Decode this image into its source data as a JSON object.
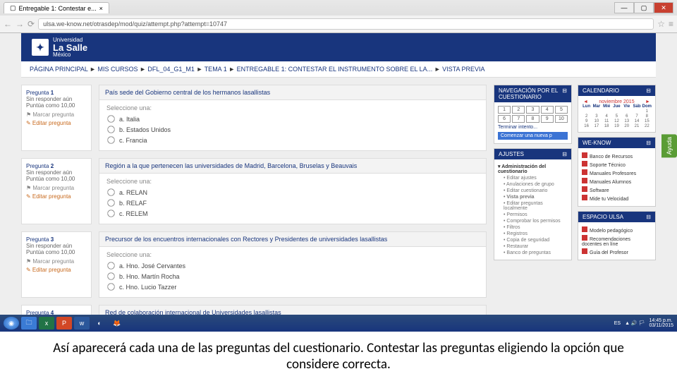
{
  "browser": {
    "tab_title": "Entregable 1: Contestar e...",
    "url": "ulsa.we-know.net/otrasdep/mod/quiz/attempt.php?attempt=10747"
  },
  "logo": {
    "top": "Universidad",
    "name": "La Salle",
    "sub": "México"
  },
  "breadcrumb": {
    "items": [
      "PÁGINA PRINCIPAL",
      "MIS CURSOS",
      "DFL_04_G1_M1",
      "TEMA 1",
      "ENTREGABLE 1: CONTESTAR EL INSTRUMENTO SOBRE EL LA...",
      "VISTA PREVIA"
    ]
  },
  "labels": {
    "question_prefix": "Pregunta",
    "select_one": "Seleccione una:",
    "not_answered": "Sin responder aún",
    "points": "Puntúa como 10,00",
    "flag": "Marcar pregunta",
    "edit": "Editar pregunta"
  },
  "questions": [
    {
      "num": "1",
      "title": "País sede del Gobierno central de los hermanos lasallistas",
      "options": [
        "a. Italia",
        "b. Estados Unidos",
        "c. Francia"
      ]
    },
    {
      "num": "2",
      "title": "Región a la que pertenecen las universidades de Madrid, Barcelona, Bruselas y Beauvais",
      "options": [
        "a. RELAN",
        "b. RELAF",
        "c. RELEM"
      ]
    },
    {
      "num": "3",
      "title": "Precursor de los encuentros internacionales con Rectores y Presidentes de universidades lasallistas",
      "options": [
        "a. Hno. José Cervantes",
        "b. Hno. Martín Rocha",
        "c. Hno. Lucio Tazzer"
      ]
    },
    {
      "num": "4",
      "title": "Red de colaboración internacional de Universidades lasallistas",
      "options": []
    }
  ],
  "navWidget": {
    "title": "NAVEGACIÓN POR EL CUESTIONARIO",
    "nums": [
      "1",
      "2",
      "3",
      "4",
      "5",
      "6",
      "7",
      "8",
      "9",
      "10"
    ],
    "finish": "Terminar intento...",
    "new": "Comenzar una nueva p"
  },
  "calendar": {
    "title": "CALENDARIO",
    "month": "noviembre 2015",
    "days": [
      "Lun",
      "Mar",
      "Mié",
      "Jue",
      "Vie",
      "Sáb",
      "Dom"
    ]
  },
  "ajustes": {
    "title": "AJUSTES",
    "items": [
      {
        "t": "Administración del cuestionario",
        "b": true
      },
      {
        "t": "Editar ajustes",
        "s": true
      },
      {
        "t": "Anulaciones de grupo",
        "s": true
      },
      {
        "t": "Editar cuestionario",
        "s": true
      },
      {
        "t": "Vista previa",
        "s": true,
        "b": true
      },
      {
        "t": "Editar preguntas localmente",
        "s": true
      },
      {
        "t": "Permisos",
        "s": true
      },
      {
        "t": "Comprobar los permisos",
        "s": true
      },
      {
        "t": "Filtros",
        "s": true
      },
      {
        "t": "Registros",
        "s": true
      },
      {
        "t": "Copia de seguridad",
        "s": true
      },
      {
        "t": "Restaurar",
        "s": true
      },
      {
        "t": "Banco de preguntas",
        "s": true
      }
    ]
  },
  "weknow": {
    "title": "WE-KNOW",
    "items": [
      "Banco de Recursos",
      "Soporte Técnico",
      "Manuales Profesores",
      "Manuales Alumnos",
      "Software",
      "Mide tu Velocidad"
    ]
  },
  "espacio": {
    "title": "ESPACIO ULSA",
    "items": [
      "Modelo pedagógico",
      "Recomendaciones docentes en líne",
      "Guía del Profesor"
    ]
  },
  "ayuda": "Ayuda",
  "taskbar": {
    "lang": "ES",
    "time": "14:45 p.m.",
    "date": "03/11/2015"
  },
  "caption": "Así aparecerá cada una de las preguntas del cuestionario. Contestar las preguntas eligiendo la opción que considere correcta."
}
